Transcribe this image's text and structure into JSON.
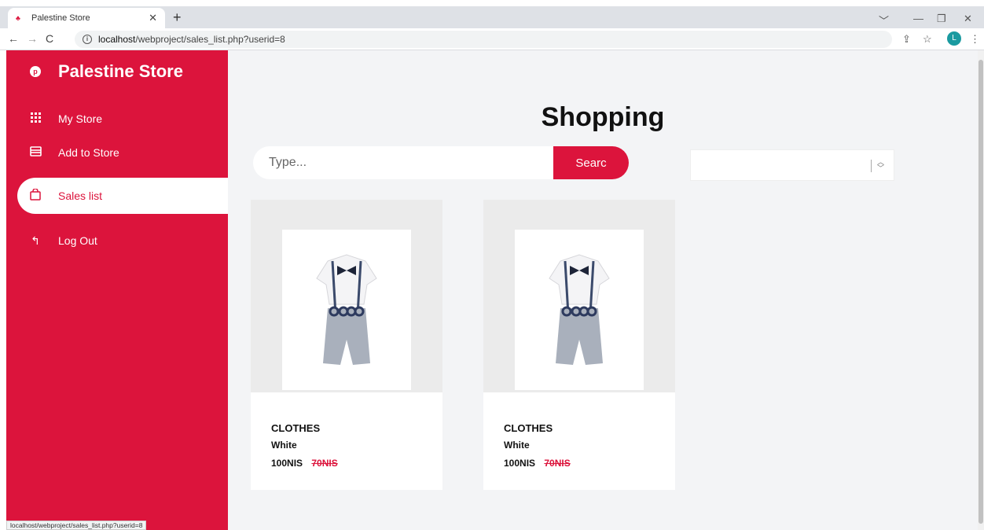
{
  "browser": {
    "tab_title": "Palestine Store",
    "url_host": "localhost",
    "url_path": "/webproject/sales_list.php?userid=8",
    "profile_initial": "L",
    "status_url": "localhost/webproject/sales_list.php?userid=8"
  },
  "sidebar": {
    "brand": "Palestine Store",
    "items": [
      {
        "label": "My Store",
        "icon": "grid-icon"
      },
      {
        "label": "Add to Store",
        "icon": "store-icon"
      },
      {
        "label": "Sales list",
        "icon": "bag-icon",
        "active": true
      },
      {
        "label": "Log Out",
        "icon": "logout-icon"
      }
    ]
  },
  "main": {
    "title": "Shopping",
    "search_placeholder": "Type...",
    "search_button": "Searc",
    "products": [
      {
        "name": "CLOTHES",
        "color": "White",
        "price": "100NIS",
        "old_price": "70NIS"
      },
      {
        "name": "CLOTHES",
        "color": "White",
        "price": "100NIS",
        "old_price": "70NIS"
      }
    ]
  },
  "colors": {
    "accent": "#dc143c"
  }
}
